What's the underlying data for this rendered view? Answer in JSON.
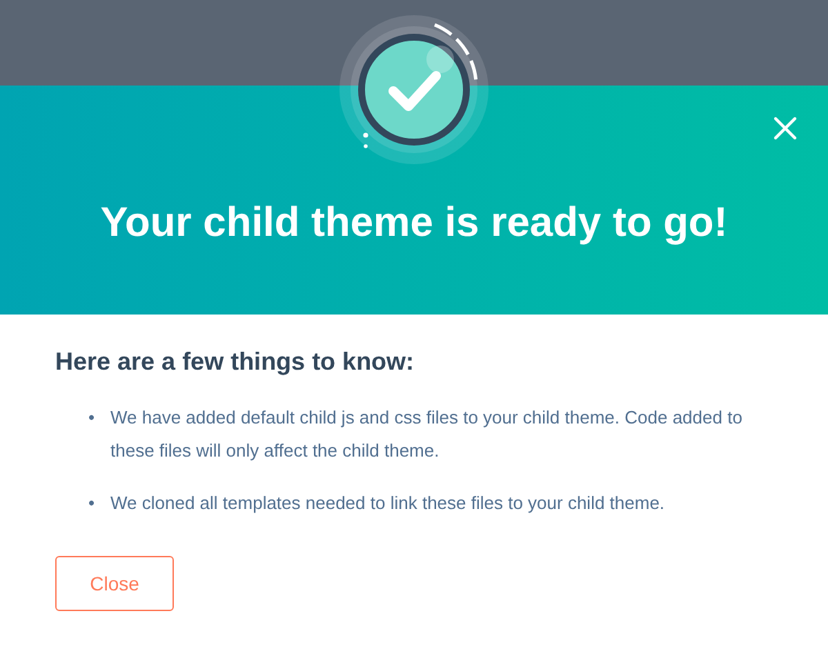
{
  "dialog": {
    "title": "Your child theme is ready to go!",
    "heading": "Here are a few things to know:",
    "notes": [
      {
        "bullet": "•",
        "text": "We have added default child js and css files to your child theme. Code added to these files will only affect the child theme."
      },
      {
        "bullet": "•",
        "text": "We cloned all templates needed to link these files to your child theme."
      }
    ],
    "buttons": [
      "Close"
    ]
  }
}
